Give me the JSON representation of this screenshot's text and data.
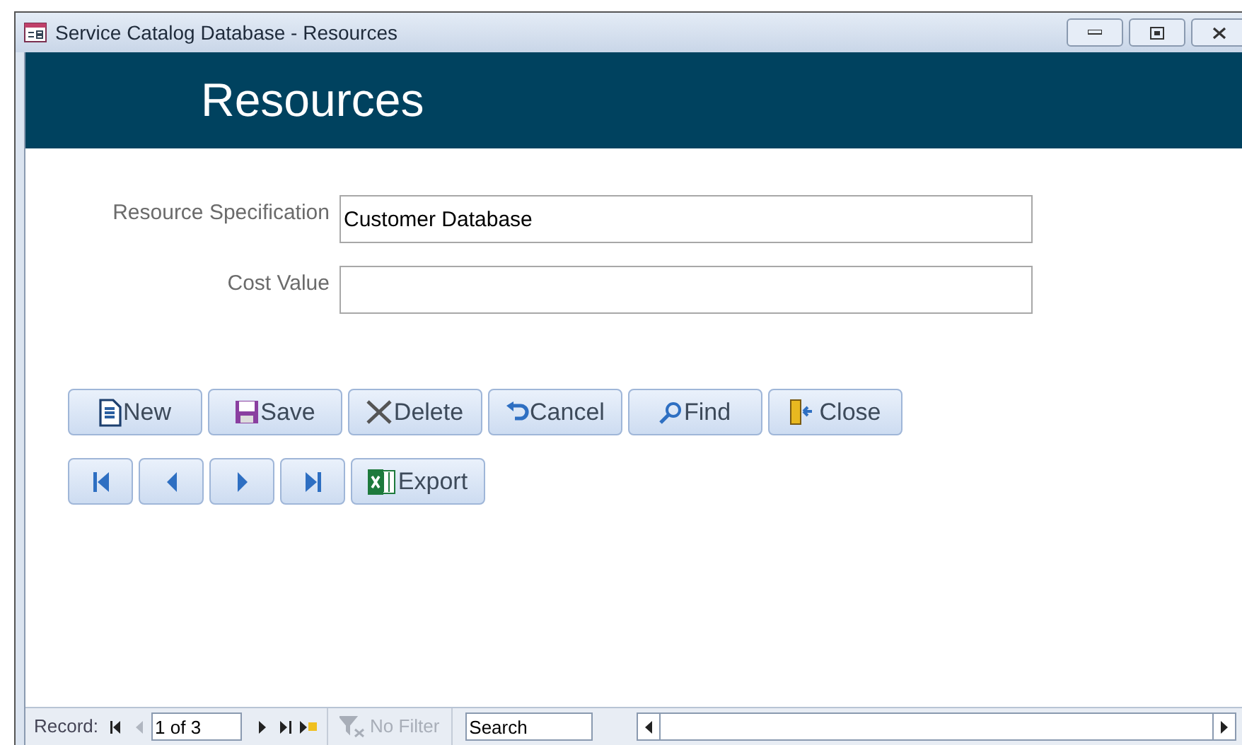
{
  "window": {
    "title": "Service Catalog Database - Resources"
  },
  "header": {
    "title": "Resources"
  },
  "fields": [
    {
      "label": "Resource Specification",
      "value": "Customer Database"
    },
    {
      "label": "Cost Value"
    }
  ],
  "action_buttons": [
    {
      "kind": "new",
      "label": "New"
    },
    {
      "kind": "save",
      "label": "Save"
    },
    {
      "kind": "delete",
      "label": "Delete"
    },
    {
      "kind": "cancel",
      "label": "Cancel"
    },
    {
      "kind": "find",
      "label": "Find"
    },
    {
      "kind": "close",
      "label": "Close"
    }
  ],
  "nav_buttons": [
    {
      "kind": "first"
    },
    {
      "kind": "previous"
    },
    {
      "kind": "next"
    },
    {
      "kind": "last"
    },
    {
      "kind": "export",
      "label": "Export"
    }
  ],
  "record_bar": {
    "label": "Record:",
    "position": "1 of 3",
    "previous_disabled": true,
    "filter": {
      "label": "No Filter",
      "disabled": true
    },
    "search": {
      "value": "Search"
    }
  }
}
